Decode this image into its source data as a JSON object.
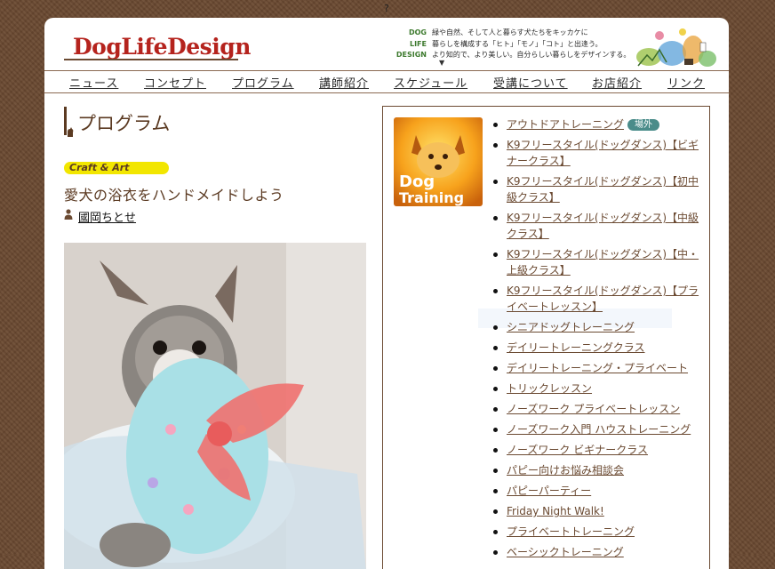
{
  "top_glyph": "?",
  "header": {
    "logo_text": "DogLifeDesign",
    "tagline_side": [
      "DOG",
      "LIFE",
      "DESIGN"
    ],
    "tagline_lines": [
      "緑や自然、そして人と暮らす犬たちをキッカケに",
      "暮らしを構成する「ヒト」「モノ」「コト」と出逢う。",
      "より知的で、より美しい。自分らしい暮らしをデザインする。"
    ],
    "tagline_arrow": "▼"
  },
  "nav": [
    "ニュース",
    "コンセプト",
    "プログラム",
    "講師紹介",
    "スケジュール",
    "受講について",
    "お店紹介",
    "リンク"
  ],
  "main": {
    "page_title": "プログラム",
    "category": "Craft & Art",
    "article_title": "愛犬の浴衣をハンドメイドしよう",
    "author": "國岡ちとせ"
  },
  "sidebar": {
    "image_text": [
      "Dog",
      "Training"
    ],
    "items": [
      {
        "label": "アウトドアトレーニング",
        "badge": "場外"
      },
      {
        "label": "K9フリースタイル(ドッグダンス)【ビギナークラス】"
      },
      {
        "label": "K9フリースタイル(ドッグダンス)【初中級クラス】"
      },
      {
        "label": "K9フリースタイル(ドッグダンス)【中級クラス】"
      },
      {
        "label": "K9フリースタイル(ドッグダンス)【中・上級クラス】"
      },
      {
        "label": "K9フリースタイル(ドッグダンス)【プライベートレッスン】"
      },
      {
        "label": "シニアドッグトレーニング"
      },
      {
        "label": "デイリートレーニングクラス"
      },
      {
        "label": "デイリートレーニング・プライベート"
      },
      {
        "label": "トリックレッスン"
      },
      {
        "label": "ノーズワーク プライベートレッスン"
      },
      {
        "label": "ノーズワーク入門 ハウストレーニング"
      },
      {
        "label": "ノーズワーク ビギナークラス"
      },
      {
        "label": "パピー向けお悩み相談会"
      },
      {
        "label": "パピーパーティー"
      },
      {
        "label": "Friday Night Walk!"
      },
      {
        "label": "プライベートトレーニング"
      },
      {
        "label": "ベーシックトレーニング"
      }
    ]
  }
}
